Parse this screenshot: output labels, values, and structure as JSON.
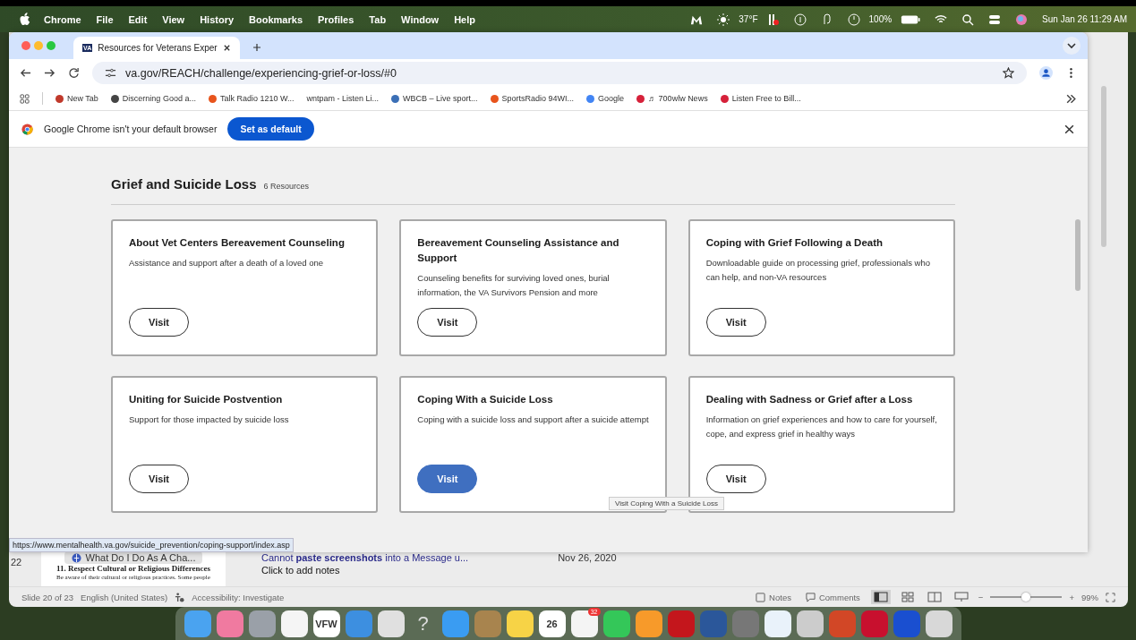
{
  "menu_bar": {
    "app": "Chrome",
    "items": [
      "File",
      "Edit",
      "View",
      "History",
      "Bookmarks",
      "Profiles",
      "Tab",
      "Window",
      "Help"
    ],
    "weather": "37°F",
    "battery": "100%",
    "clock": "Sun Jan 26  11:29 AM"
  },
  "browser": {
    "tab": {
      "title": "Resources for Veterans Exper",
      "favicon": "VA"
    },
    "address": "va.gov/REACH/challenge/experiencing-grief-or-loss/#0",
    "bookmarks": [
      {
        "label": "New Tab",
        "color": "#c0392b"
      },
      {
        "label": "Discerning Good a...",
        "color": "#444444"
      },
      {
        "label": "Talk Radio 1210 W...",
        "color": "#e8541c"
      },
      {
        "label": "wntpam - Listen Li..."
      },
      {
        "label": "WBCB – Live sport...",
        "color": "#3b6fb6"
      },
      {
        "label": "SportsRadio 94WI...",
        "color": "#e8541c"
      },
      {
        "label": "Google",
        "color": "#4285f4"
      },
      {
        "label": "♬ 700wlw News",
        "color": "#d6213a"
      },
      {
        "label": "Listen Free to Bill...",
        "color": "#d6213a"
      }
    ],
    "banner": {
      "text": "Google Chrome isn't your default browser",
      "button": "Set as default"
    },
    "section": {
      "title": "Grief and Suicide Loss",
      "count": "6 Resources"
    },
    "cards": [
      {
        "title": "About Vet Centers Bereavement Counseling",
        "description": "Assistance and support after a death of a loved one",
        "button": "Visit",
        "hovered": false
      },
      {
        "title": "Bereavement Counseling Assistance and Support",
        "description": "Counseling benefits for surviving loved ones, burial information, the VA Survivors Pension and more",
        "button": "Visit",
        "hovered": false
      },
      {
        "title": "Coping with Grief Following a Death",
        "description": "Downloadable guide on processing grief, professionals who can help, and non-VA resources",
        "button": "Visit",
        "hovered": false
      },
      {
        "title": "Uniting for Suicide Postvention",
        "description": "Support for those impacted by suicide loss",
        "button": "Visit",
        "hovered": false
      },
      {
        "title": "Coping With a Suicide Loss",
        "description": "Coping with a suicide loss and support after a suicide attempt",
        "button": "Visit",
        "hovered": true
      },
      {
        "title": "Dealing with Sadness or Grief after a Loss",
        "description": "Information on grief experiences and how to care for yourself, cope, and express grief in healthy ways",
        "button": "Visit",
        "hovered": false
      }
    ],
    "tooltip": "Visit Coping With a Suicide Loss",
    "status_url": "https://www.mentalhealth.va.gov/suicide_prevention/coping-support/index.asp"
  },
  "presentation": {
    "slide_number": "22",
    "thumbnail_title": "11. Respect Cultural or Religious Differences",
    "thumbnail_text": "Be aware of their cultural or religious practices. Some people",
    "notification_title": "What Do I Do As A Cha...",
    "message": "Cannot **paste screenshots** into a Message u...",
    "date": "Nov 26, 2020",
    "notes_placeholder": "Click to add notes",
    "status": {
      "slide": "Slide 20 of 23",
      "language": "English (United States)",
      "accessibility": "Accessibility: Investigate",
      "notes": "Notes",
      "comments": "Comments",
      "zoom_minus": "−",
      "zoom_plus": "+",
      "zoom": "99%",
      "level": 0.5
    }
  },
  "dock": [
    {
      "color": "#4aa3f0"
    },
    {
      "color": "#f07aa0"
    },
    {
      "color": "#9aa0a8"
    },
    {
      "color": "#f5f5f5"
    },
    {
      "color": "#ffffff",
      "label": "VFW"
    },
    {
      "color": "#3d8fe0"
    },
    {
      "color": "#e0e0e0"
    },
    {
      "label": "?"
    },
    {
      "color": "#3a9cf2"
    },
    {
      "color": "#a8844e"
    },
    {
      "color": "#f7d346"
    },
    {
      "color": "#ffffff",
      "label": "26"
    },
    {
      "color": "#f4f4f4",
      "badge": "32"
    },
    {
      "color": "#34c759"
    },
    {
      "color": "#f79a2a"
    },
    {
      "color": "#c4161c"
    },
    {
      "color": "#2b579a"
    },
    {
      "color": "#777777"
    },
    {
      "color": "#e9f2fa"
    },
    {
      "color": "#cccccc"
    },
    {
      "color": "#d24726"
    },
    {
      "color": "#c8102e"
    },
    {
      "color": "#1a4fd0"
    },
    {
      "color": "#d8d8d8"
    }
  ]
}
